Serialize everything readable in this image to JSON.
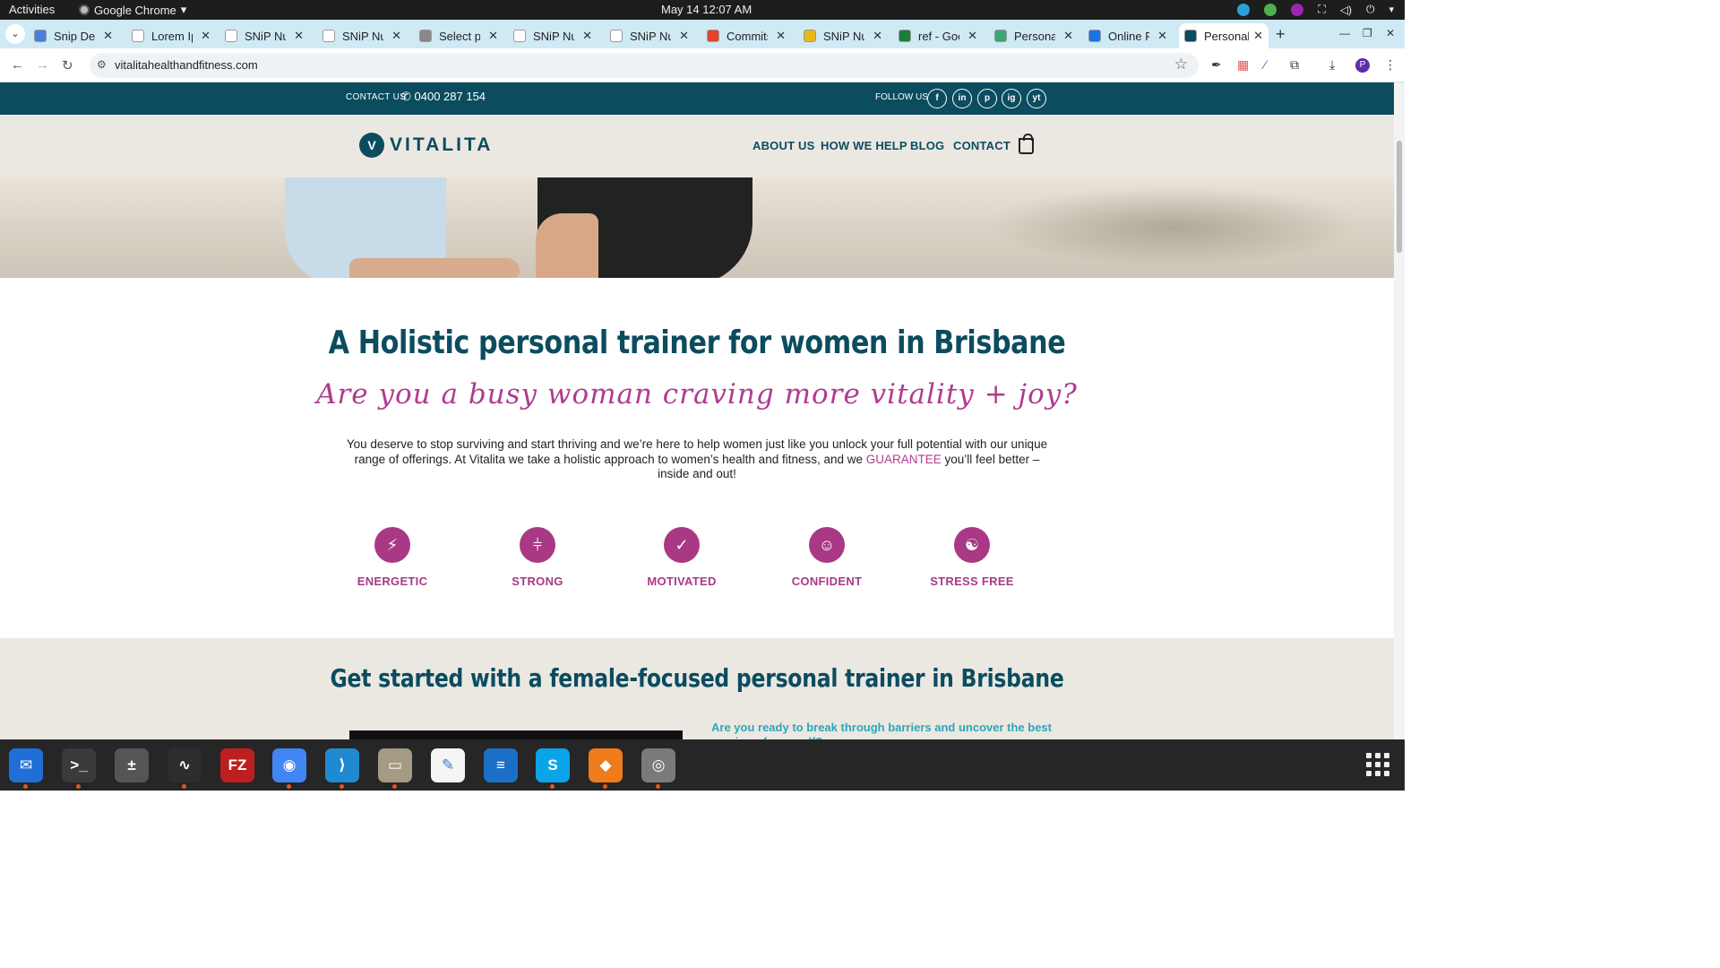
{
  "system": {
    "activities": "Activities",
    "app_name": "Google Chrome",
    "clock": "May 14  12:07 AM"
  },
  "tabs": [
    {
      "label": "Snip Det",
      "icon_color": "#4a7fe0",
      "icon": "doc-icon"
    },
    {
      "label": "Lorem Ip",
      "icon_color": "#ffffff",
      "icon": "lorem-icon"
    },
    {
      "label": "SNiP Nu",
      "icon_color": "#ffffff",
      "icon": "snip-icon"
    },
    {
      "label": "SNiP Nu",
      "icon_color": "#ffffff",
      "icon": "snip-icon"
    },
    {
      "label": "Select pr",
      "icon_color": "#888888",
      "icon": "globe-icon"
    },
    {
      "label": "SNiP Nu",
      "icon_color": "#ffffff",
      "icon": "snip-icon"
    },
    {
      "label": "SNiP Nu",
      "icon_color": "#ffffff",
      "icon": "snip-icon"
    },
    {
      "label": "Commits",
      "icon_color": "#e24329",
      "icon": "gitlab-icon"
    },
    {
      "label": "SNiP Nu",
      "icon_color": "#e8b818",
      "icon": "snip-icon"
    },
    {
      "label": "ref - Goo",
      "icon_color": "#188038",
      "icon": "sheets-icon"
    },
    {
      "label": "Personal",
      "icon_color": "#3aa676",
      "icon": "personal-icon"
    },
    {
      "label": "Online F",
      "icon_color": "#1a73e8",
      "icon": "online-icon"
    },
    {
      "label": "Personal",
      "icon_color": "#0b4c5f",
      "icon": "vitalita-icon"
    }
  ],
  "address_bar": {
    "url": "vitalitahealthandfitness.com"
  },
  "site": {
    "contact_label": "CONTACT US",
    "phone": "0400 287 154",
    "follow_label": "FOLLOW US",
    "social": [
      "f",
      "in",
      "p",
      "ig",
      "yt"
    ],
    "logo_mark": "V",
    "logo_text": "VITALITA",
    "nav": [
      "ABOUT US",
      "HOW WE HELP",
      "BLOG",
      "CONTACT"
    ],
    "headline": "A Holistic personal trainer for women in Brisbane",
    "script_heading": "Are you a busy woman craving more vitality + joy?",
    "body_before": "You deserve to stop surviving and start thriving and we’re here to help women just like you unlock your full potential with our unique range of offerings. At Vitalita we take a holistic approach to women’s health and fitness, and we ",
    "body_highlight": "GUARANTEE",
    "body_after": " you’ll feel better – inside and out!",
    "benefits": [
      {
        "label": "ENERGETIC",
        "glyph": "⚡",
        "icon": "lightning-icon"
      },
      {
        "label": "STRONG",
        "glyph": "⫩",
        "icon": "dumbbell-icon"
      },
      {
        "label": "MOTIVATED",
        "glyph": "✓",
        "icon": "check-icon"
      },
      {
        "label": "CONFIDENT",
        "glyph": "☺",
        "icon": "smiley-icon"
      },
      {
        "label": "STRESS FREE",
        "glyph": "☯",
        "icon": "yin-yang-icon"
      }
    ],
    "section2_heading": "Get started with a female-focused personal trainer in Brisbane",
    "section2_teaser": "Are you ready to break through barriers and uncover the best version of yourself?"
  },
  "colors": {
    "brand_teal": "#0b4c5f",
    "accent_magenta": "#a93985",
    "teaser_cyan": "#2aa7b8",
    "beige": "#ebe8e2"
  },
  "dock": [
    {
      "name": "thunderbird",
      "bg": "#1f6fd6",
      "glyph": "✉"
    },
    {
      "name": "terminal",
      "bg": "#3a3a3a",
      "glyph": ">_"
    },
    {
      "name": "calculator",
      "bg": "#555555",
      "glyph": "±"
    },
    {
      "name": "system-monitor",
      "bg": "#2d2d2d",
      "glyph": "∿"
    },
    {
      "name": "filezilla",
      "bg": "#bf1e1e",
      "glyph": "FZ"
    },
    {
      "name": "chrome",
      "bg": "#4285f4",
      "glyph": "◉"
    },
    {
      "name": "vscode",
      "bg": "#1f8ad2",
      "glyph": "⟩"
    },
    {
      "name": "files",
      "bg": "#a59a83",
      "glyph": "▭"
    },
    {
      "name": "text-editor",
      "bg": "#f4f4f4",
      "glyph": "✎"
    },
    {
      "name": "writer",
      "bg": "#1b6fc7",
      "glyph": "≡"
    },
    {
      "name": "skype",
      "bg": "#0aa5e8",
      "glyph": "S"
    },
    {
      "name": "app-orange",
      "bg": "#f07b1a",
      "glyph": "◆"
    },
    {
      "name": "disk",
      "bg": "#7a7a7a",
      "glyph": "◎"
    }
  ]
}
